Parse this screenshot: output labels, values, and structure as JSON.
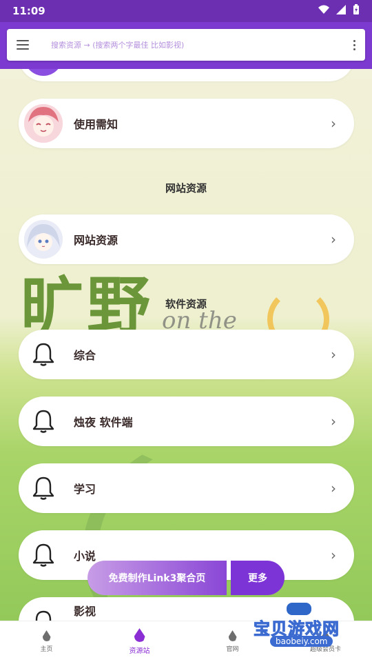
{
  "status_bar": {
    "time": "11:09"
  },
  "header": {
    "search_placeholder": "搜索资源  →  (搜索两个字最佳 比如影视)"
  },
  "cards": {
    "usage": "使用需知",
    "website": "网站资源",
    "general": "综合",
    "zhuye": "烛夜 软件端",
    "study": "学习",
    "novel": "小说",
    "video": "影视"
  },
  "sections": {
    "website_title": "网站资源",
    "software_title": "软件资源"
  },
  "cta": {
    "make_label": "免费制作Link3聚合页",
    "more_label": "更多"
  },
  "bottom_nav": {
    "items": [
      {
        "label": "主页"
      },
      {
        "label": "资源站"
      },
      {
        "label": "官网"
      },
      {
        "label": "超级会员卡"
      }
    ],
    "active_index": 1
  },
  "watermark": {
    "title": "宝贝游戏网",
    "url": "baobeiy.com"
  },
  "colors": {
    "status_bar": "#6d2fb2",
    "header": "#7c3ad0",
    "accent": "#8b2fd4"
  }
}
